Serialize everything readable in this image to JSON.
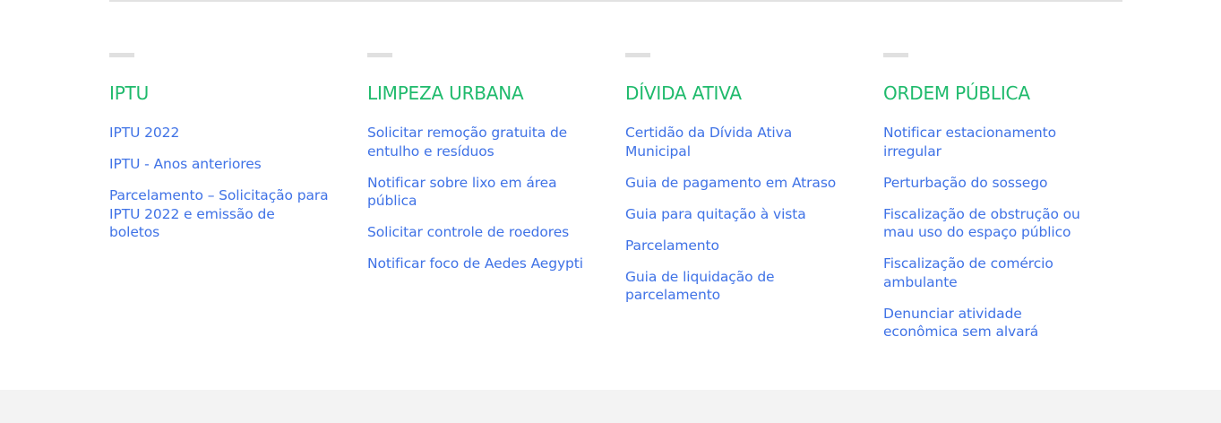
{
  "colors": {
    "heading": "#1fba6c",
    "link": "#3f72e6",
    "dash": "#e0e0e0",
    "footer_band": "#f3f3f3"
  },
  "columns": [
    {
      "title": "IPTU",
      "links": [
        "IPTU 2022",
        "IPTU - Anos anteriores",
        "Parcelamento – Solicitação para IPTU 2022 e emissão de boletos"
      ]
    },
    {
      "title": "LIMPEZA URBANA",
      "links": [
        "Solicitar remoção gratuita de entulho e resíduos",
        "Notificar sobre lixo em área pública",
        "Solicitar controle de roedores",
        "Notificar foco de Aedes Aegypti"
      ]
    },
    {
      "title": "DÍVIDA ATIVA",
      "links": [
        "Certidão da Dívida Ativa Municipal",
        "Guia de pagamento em Atraso",
        "Guia para quitação à vista",
        "Parcelamento",
        "Guia de liquidação de parcelamento"
      ]
    },
    {
      "title": "ORDEM PÚBLICA",
      "links": [
        "Notificar estacionamento irregular",
        "Perturbação do sossego",
        "Fiscalização de obstrução ou mau uso do espaço público",
        "Fiscalização de comércio ambulante",
        "Denunciar atividade econômica sem alvará"
      ]
    }
  ]
}
